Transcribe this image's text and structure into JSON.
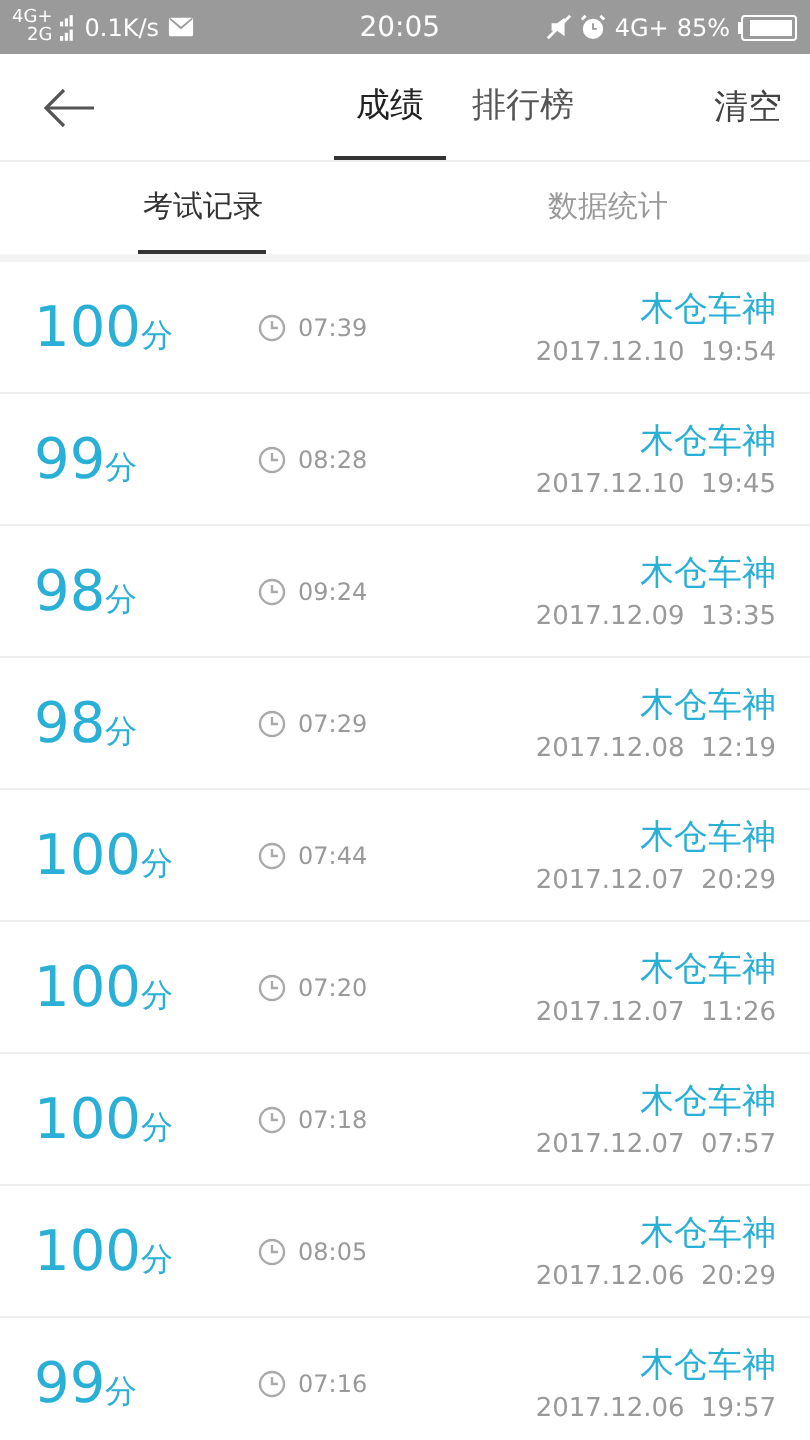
{
  "status_bar": {
    "network_1": "4G+",
    "network_2": "2G",
    "speed": "0.1K/s",
    "time": "20:05",
    "network_3": "4G+",
    "battery": "85%"
  },
  "header": {
    "tabs": [
      {
        "label": "成绩",
        "selected": true
      },
      {
        "label": "排行榜",
        "selected": false
      }
    ],
    "action": "清空"
  },
  "subtabs": [
    {
      "label": "考试记录",
      "selected": true
    },
    {
      "label": "数据统计",
      "selected": false
    }
  ],
  "records": [
    {
      "score": "100",
      "unit": "分",
      "duration": "07:39",
      "name": "木仓车神",
      "datetime": "2017.12.10  19:54"
    },
    {
      "score": "99",
      "unit": "分",
      "duration": "08:28",
      "name": "木仓车神",
      "datetime": "2017.12.10  19:45"
    },
    {
      "score": "98",
      "unit": "分",
      "duration": "09:24",
      "name": "木仓车神",
      "datetime": "2017.12.09  13:35"
    },
    {
      "score": "98",
      "unit": "分",
      "duration": "07:29",
      "name": "木仓车神",
      "datetime": "2017.12.08  12:19"
    },
    {
      "score": "100",
      "unit": "分",
      "duration": "07:44",
      "name": "木仓车神",
      "datetime": "2017.12.07  20:29"
    },
    {
      "score": "100",
      "unit": "分",
      "duration": "07:20",
      "name": "木仓车神",
      "datetime": "2017.12.07  11:26"
    },
    {
      "score": "100",
      "unit": "分",
      "duration": "07:18",
      "name": "木仓车神",
      "datetime": "2017.12.07  07:57"
    },
    {
      "score": "100",
      "unit": "分",
      "duration": "08:05",
      "name": "木仓车神",
      "datetime": "2017.12.06  20:29"
    },
    {
      "score": "99",
      "unit": "分",
      "duration": "07:16",
      "name": "木仓车神",
      "datetime": "2017.12.06  19:57"
    }
  ]
}
